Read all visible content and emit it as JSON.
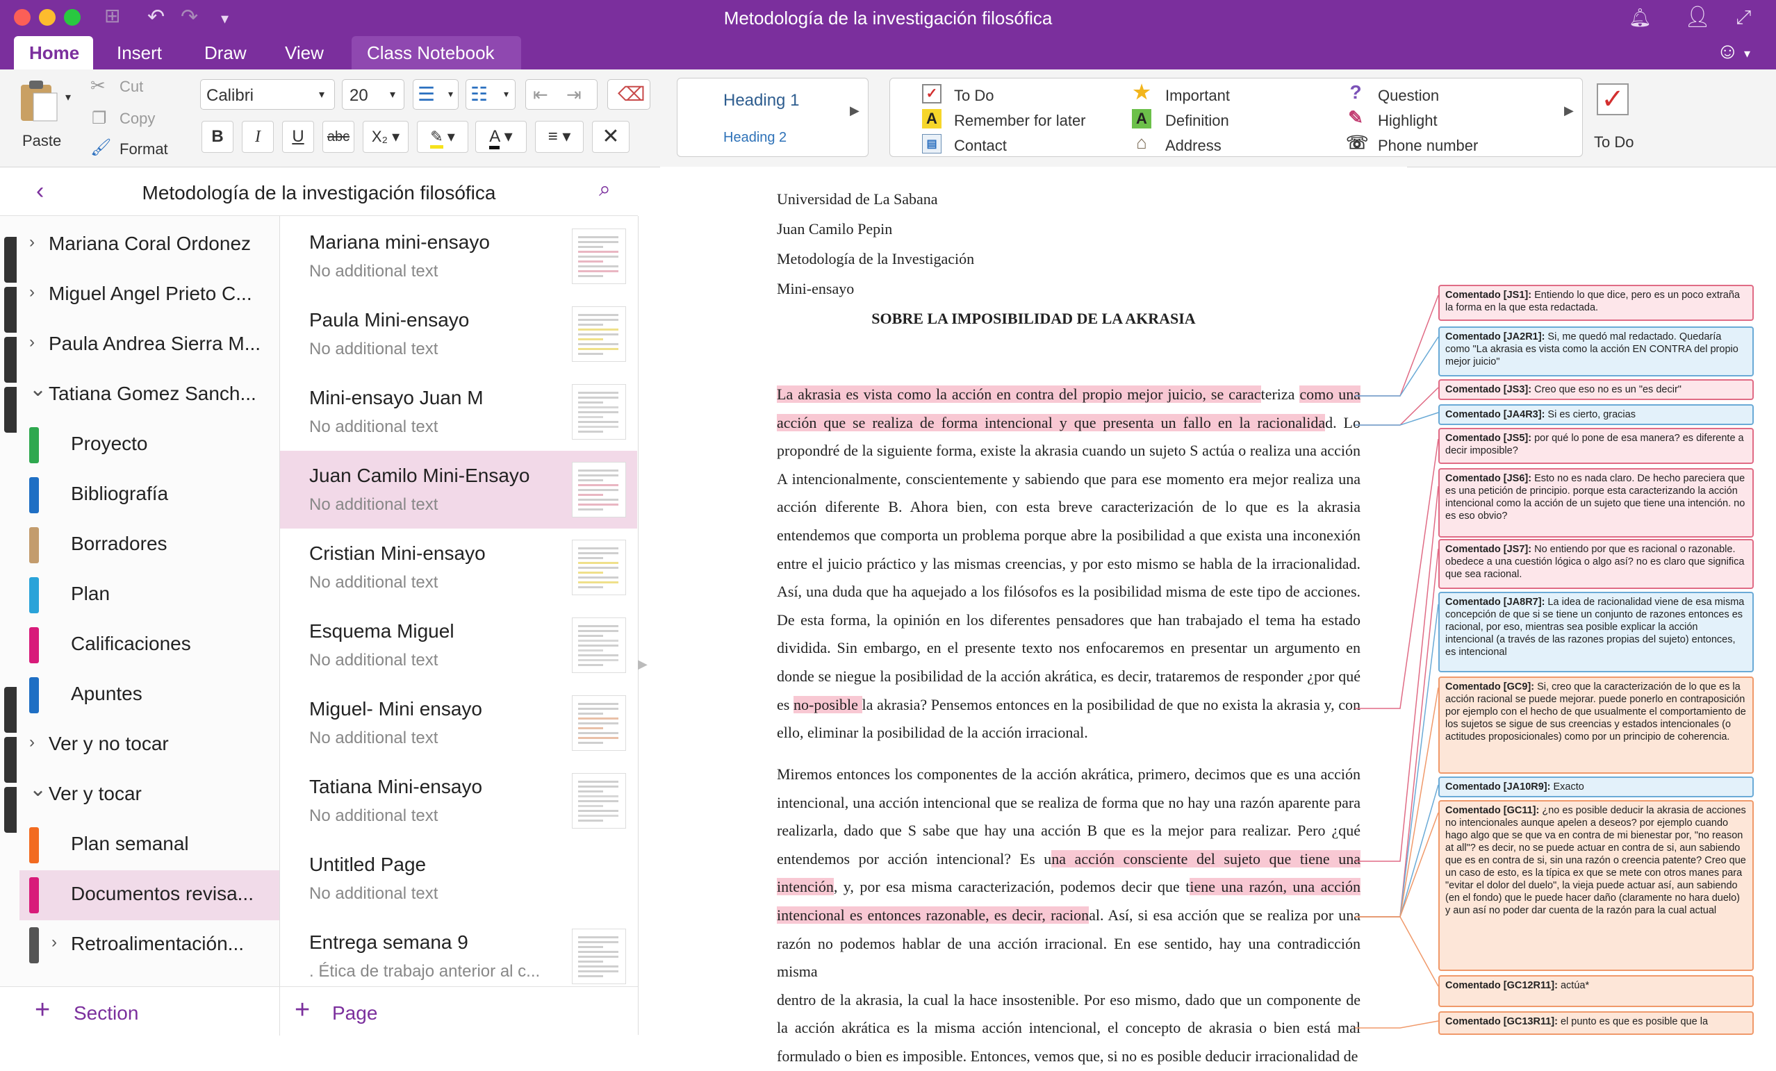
{
  "window": {
    "title": "Metodología de la investigación filosófica"
  },
  "tabs": [
    "Home",
    "Insert",
    "Draw",
    "View",
    "Class Notebook"
  ],
  "ribbon": {
    "paste": "Paste",
    "cut": "Cut",
    "copy": "Copy",
    "format": "Format",
    "font_name": "Calibri",
    "font_size": "20",
    "styles": {
      "h1": "Heading 1",
      "h2": "Heading 2"
    },
    "tags": {
      "todo": "To Do",
      "remember": "Remember for later",
      "contact": "Contact",
      "important": "Important",
      "definition": "Definition",
      "address": "Address",
      "question": "Question",
      "highlight": "Highlight",
      "phone": "Phone number"
    },
    "todo_big": "To Do"
  },
  "nav": {
    "notebook_title": "Metodología de la investigación filosófica"
  },
  "sections": [
    {
      "label": "Mariana Coral Ordonez",
      "kind": "group",
      "expanded": false
    },
    {
      "label": "Miguel Angel Prieto C...",
      "kind": "group",
      "expanded": false
    },
    {
      "label": "Paula Andrea Sierra M...",
      "kind": "group",
      "expanded": false
    },
    {
      "label": "Tatiana Gomez Sanch...",
      "kind": "group",
      "expanded": true
    },
    {
      "label": "Proyecto",
      "kind": "section",
      "color": "#2fa84f"
    },
    {
      "label": "Bibliografía",
      "kind": "section",
      "color": "#1f6fc4"
    },
    {
      "label": "Borradores",
      "kind": "section",
      "color": "#c39c6d"
    },
    {
      "label": "Plan",
      "kind": "section",
      "color": "#2aa3d9"
    },
    {
      "label": "Calificaciones",
      "kind": "section",
      "color": "#d81b7a"
    },
    {
      "label": "Apuntes",
      "kind": "section",
      "color": "#1f6fc4"
    },
    {
      "label": "Ver y no tocar",
      "kind": "group",
      "expanded": false
    },
    {
      "label": "Ver y tocar",
      "kind": "group",
      "expanded": true
    },
    {
      "label": "Plan semanal",
      "kind": "section",
      "color": "#f26b21"
    },
    {
      "label": "Documentos revisa...",
      "kind": "section",
      "color": "#d81b7a",
      "selected": true
    },
    {
      "label": "Retroalimentación...",
      "kind": "subgroup",
      "color": "#555555"
    }
  ],
  "pages": [
    {
      "title": "Mariana mini-ensayo",
      "preview": "No additional text"
    },
    {
      "title": "Paula Mini-ensayo",
      "preview": "No additional text"
    },
    {
      "title": "Mini-ensayo Juan M",
      "preview": "No additional text"
    },
    {
      "title": "Juan Camilo Mini-Ensayo",
      "preview": "No additional text",
      "selected": true
    },
    {
      "title": "Cristian Mini-ensayo",
      "preview": "No additional text"
    },
    {
      "title": "Esquema Miguel",
      "preview": "No additional text"
    },
    {
      "title": "Miguel- Mini ensayo",
      "preview": "No additional text"
    },
    {
      "title": "Tatiana Mini-ensayo",
      "preview": "No additional text"
    },
    {
      "title": "Untitled Page",
      "preview": "No additional text"
    },
    {
      "title": "Entrega semana 9",
      "preview": ". Ética de trabajo anterior al c..."
    }
  ],
  "bottom": {
    "add_section": "Section",
    "add_page": "Page"
  },
  "document": {
    "header_lines": [
      "Universidad de La Sabana",
      "Juan Camilo Pepin",
      "Metodología de la Investigación",
      "Mini-ensayo"
    ],
    "title": "SOBRE LA IMPOSIBILIDAD DE LA AKRASIA",
    "p1": [
      "La akrasia es vista como la acción en contra del propio mejor juicio, se caracteriza como una",
      "acción que se realiza de forma intencional y que presenta un fallo en la racionalidad. Lo",
      "propondré de la siguiente forma, existe la akrasia cuando un sujeto S actúa o realiza una acción",
      "A intencionalmente, conscientemente y sabiendo que para ese momento era mejor realiza una",
      "acción diferente B. Ahora bien, con esta breve caracterización de lo que es la akrasia",
      "entendemos que comporta un problema porque abre la posibilidad a que exista una inconexión",
      "entre el juicio práctico y las mismas creencias, y por esto mismo se habla de la irracionalidad.",
      "Así, una duda que ha aquejado a los filósofos es la posibilidad misma de este tipo de acciones.",
      "De esta forma, la opinión en los diferentes pensadores que han trabajado el tema ha estado",
      "dividida. Sin embargo, en el presente texto nos enfocaremos en presentar un argumento en",
      "donde se niegue la posibilidad de la acción akrática, es decir, trataremos de responder ¿por qué",
      "es no-posible la akrasia? Pensemos entonces en la posibilidad de que no exista la akrasia y, con",
      "ello, eliminar la posibilidad de la acción irracional."
    ],
    "p2": [
      "Miremos entonces los componentes de la acción akrática, primero, decimos que es una acción",
      "intencional, una acción intencional que se realiza de forma que no hay una razón aparente para",
      "realizarla, dado que S sabe que hay una acción B que es la mejor para realizar. Pero ¿qué",
      "entendemos por acción intencional? Es una acción consciente del sujeto que tiene una",
      "intención, y, por esa misma caracterización, podemos decir que tiene una razón, una acción",
      "intencional es entonces razonable, es decir, racional. Así, si esa acción que se realiza por una",
      "razón no podemos hablar de una acción irracional. En ese sentido, hay una contradicción misma",
      "dentro de la akrasia, la cual la hace insostenible. Por eso mismo, dado que un componente de",
      "la acción akrática es la misma acción intencional, el concepto de akrasia o bien está mal",
      "formulado o bien es imposible. Entonces, vemos que, si no es posible deducir irracionalidad de"
    ]
  },
  "comments": [
    {
      "label": "Comentado [JS1]:",
      "text": "Entiendo lo que dice, pero es un poco extraña la forma en la que esta redactada.",
      "color": "red"
    },
    {
      "label": "Comentado [JA2R1]:",
      "text": "Si, me quedó mal redactado. Quedaría como \"La akrasia es vista como la acción EN CONTRA del propio mejor juicio\"",
      "color": "blue"
    },
    {
      "label": "Comentado [JS3]:",
      "text": "Creo que eso no es un \"es decir\"",
      "color": "red"
    },
    {
      "label": "Comentado [JA4R3]:",
      "text": "Si es cierto, gracias",
      "color": "blue"
    },
    {
      "label": "Comentado [JS5]:",
      "text": "por qué lo pone de esa manera? es diferente a decir imposible?",
      "color": "red"
    },
    {
      "label": "Comentado [JS6]:",
      "text": "Esto no es nada claro. De hecho pareciera que es una petición de principio. porque esta caracterizando la acción intencional como la acción de un sujeto que tiene una intención. no es eso obvio?",
      "color": "red"
    },
    {
      "label": "Comentado [JS7]:",
      "text": "No entiendo por que es racional o razonable. obedece a una cuestión lógica o algo así? no es claro que significa que sea racional.",
      "color": "red"
    },
    {
      "label": "Comentado [JA8R7]:",
      "text": "La idea de racionalidad viene de esa misma concepción de que si se tiene un conjunto de razones entonces es racional, por eso, mientras sea posible explicar la acción intencional (a través de las razones propias del sujeto) entonces, es intencional",
      "color": "blue"
    },
    {
      "label": "Comentado [GC9]:",
      "text": "Si, creo que la caracterización de lo que es la acción racional se puede mejorar. puede ponerlo en contraposición por ejemplo con el hecho de que usualmente el comportamiento de los sujetos se sigue de sus creencias y estados intencionales (o actitudes proposicionales) como por un principio de coherencia.",
      "color": "orange"
    },
    {
      "label": "Comentado [JA10R9]:",
      "text": "Exacto",
      "color": "blue"
    },
    {
      "label": "Comentado [GC11]:",
      "text": "¿no es posible deducir la akrasia de acciones no intencionales aunque apelen a deseos? por ejemplo cuando hago algo que se que va en contra de mi bienestar por, \"no reason at all\"? es decir, no se puede actuar en contra de si, aun sabiendo que es en contra de si, sin una razón o creencia patente? Creo que un caso de esto, es la típica ex que se mete con otros manes para \"evitar el dolor del duelo\", la vieja puede actuar así, aun sabiendo (en el fondo) que le puede hacer daño (claramente no hara duelo) y aun así no poder dar cuenta de la razón para la cual actual",
      "color": "orange"
    },
    {
      "label": "Comentado [GC12R11]:",
      "text": "actúa*",
      "color": "orange"
    },
    {
      "label": "Comentado [GC13R11]:",
      "text": "el punto es que es posible que la",
      "color": "orange"
    }
  ]
}
